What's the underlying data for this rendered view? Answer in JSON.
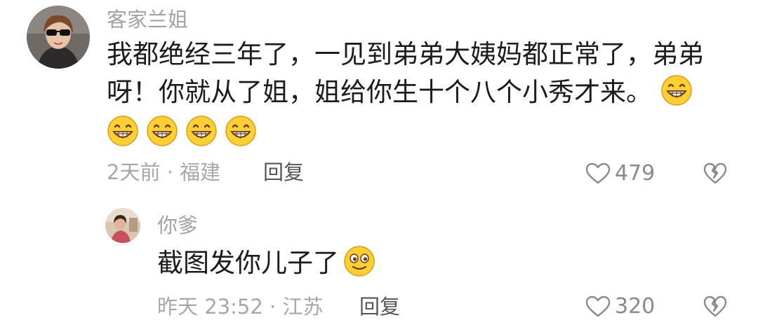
{
  "comments": [
    {
      "username": "客家兰姐",
      "text_lines": [
        "我都绝经三年了，一见到弟弟大姨妈都正常了，弟弟",
        "呀！你就从了姐，姐给你生十个八个小秀才来。"
      ],
      "trailing_emoji": "grin-emoji",
      "emoji_row": [
        "grin-emoji",
        "grin-emoji",
        "grin-emoji",
        "grin-emoji"
      ],
      "meta": "2天前 · 福建",
      "reply_label": "回复",
      "likes": "479"
    },
    {
      "username": "你爹",
      "text": "截图发你儿子了",
      "trailing_emoji": "smile-emoji",
      "meta": "昨天 23:52 · 江苏",
      "reply_label": "回复",
      "likes": "320"
    }
  ],
  "colors": {
    "username": "#a3a3a3",
    "text": "#1c1c1c",
    "meta": "#a8a8a8",
    "reply": "#555555",
    "like_icon": "#8a8a8a",
    "emoji_face": "#ffd034",
    "emoji_outline": "#e09a1a"
  }
}
